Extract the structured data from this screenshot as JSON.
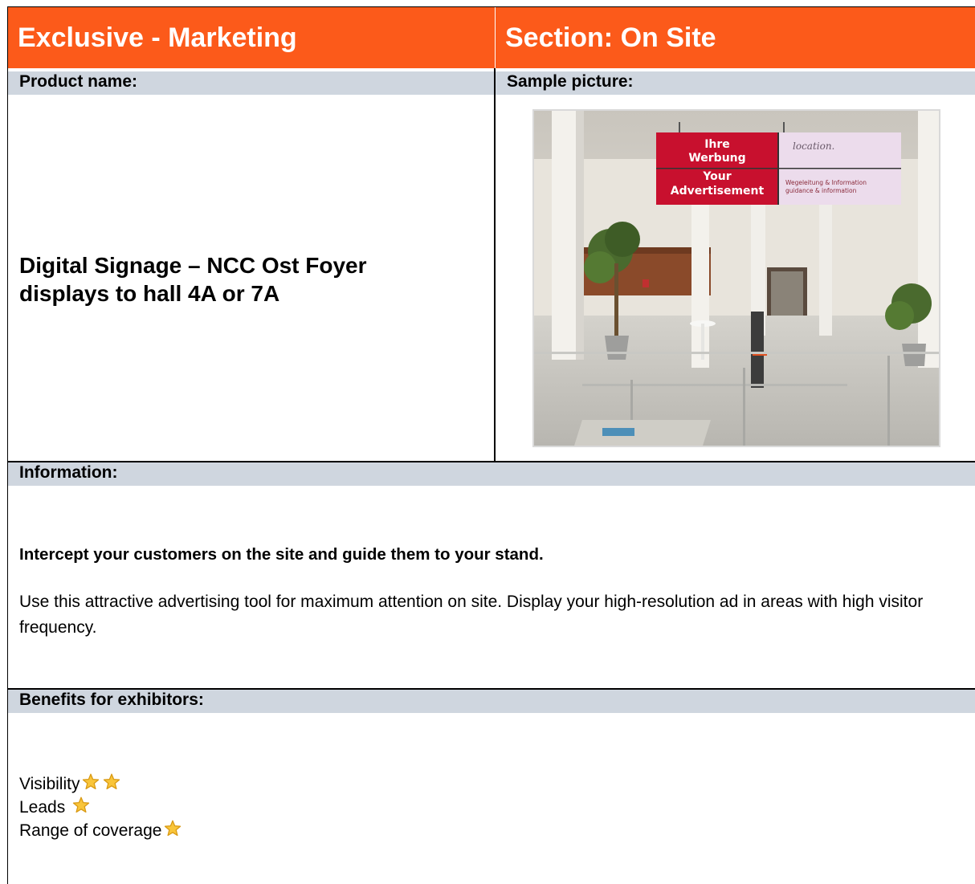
{
  "header": {
    "left_title": "Exclusive - Marketing",
    "right_title": "Section: On Site"
  },
  "labels": {
    "product_name": "Product name:",
    "sample_picture": "Sample picture:",
    "information": "Information:",
    "benefits": "Benefits for exhibitors:"
  },
  "product": {
    "name_line1": "Digital Signage – NCC Ost Foyer",
    "name_line2": "displays to hall 4A or 7A"
  },
  "sample_image": {
    "sign_left": [
      "Ihre",
      "Werbung",
      "Your",
      "Advertisement"
    ],
    "sign_right_logo": "location.",
    "sign_right_line1": "Wegeleitung & Information",
    "sign_right_line2": "guidance & information"
  },
  "information": {
    "lead": "Intercept your customers on the site and guide them to your stand.",
    "body": "Use this attractive advertising tool for maximum attention on site. Display your high-resolution ad in areas with high visitor frequency."
  },
  "benefits": [
    {
      "label": "Visibility",
      "stars": 2
    },
    {
      "label": "Leads",
      "stars": 1
    },
    {
      "label": "Range of coverage",
      "stars": 1
    }
  ],
  "colors": {
    "header_orange": "#fc5a1a",
    "band_gray": "#cfd6df",
    "star_fill": "#f9c53a",
    "star_stroke": "#d99a14"
  }
}
